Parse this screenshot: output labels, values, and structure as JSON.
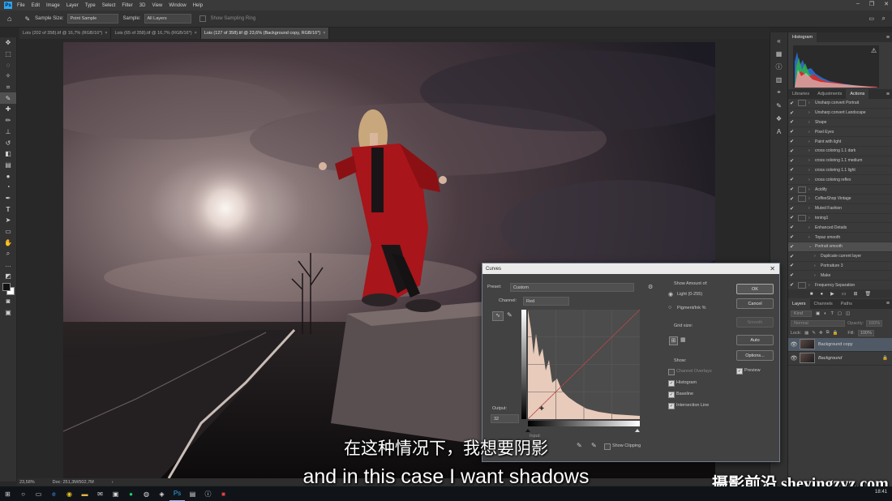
{
  "menu": [
    "File",
    "Edit",
    "Image",
    "Layer",
    "Type",
    "Select",
    "Filter",
    "3D",
    "View",
    "Window",
    "Help"
  ],
  "app_logo": "Ps",
  "options": {
    "sample_size_label": "Sample Size:",
    "sample_size_value": "Point Sample",
    "sample_label": "Sample:",
    "sample_value": "All Layers",
    "ring_label": "Show Sampling Ring"
  },
  "tabs": [
    {
      "label": "Lois (202 of 358).tif @ 16,7% (RGB/16*)",
      "close": "×"
    },
    {
      "label": "Lois (65 of 358).tif @ 16,7% (RGB/16*)",
      "close": "×"
    },
    {
      "label": "Lois (127 of 358).tif @ 23,6% (Background copy, RGB/16*)",
      "close": "×"
    }
  ],
  "status": {
    "zoom": "23,58%",
    "doc": "Doc: 251,3M/502,7M"
  },
  "panels": {
    "histogram_tab": "Histogram",
    "mid_tabs": [
      "Libraries",
      "Adjustments",
      "Actions"
    ],
    "actions": [
      {
        "name": "Unsharp convert Portrait",
        "check": "✔",
        "box": true,
        "tri": "›"
      },
      {
        "name": "Unsharp convert Landscape",
        "check": "✔",
        "box": false,
        "tri": "›"
      },
      {
        "name": "Shape",
        "check": "✔",
        "box": false,
        "tri": "›"
      },
      {
        "name": "Pixel Eyes",
        "check": "✔",
        "box": false,
        "tri": "›"
      },
      {
        "name": "Paint with light",
        "check": "✔",
        "box": false,
        "tri": "›"
      },
      {
        "name": "cross coloring 1.1 dark",
        "check": "✔",
        "box": false,
        "tri": "›"
      },
      {
        "name": "cross coloring 1.1 medium",
        "check": "✔",
        "box": false,
        "tri": "›"
      },
      {
        "name": "cross coloring 1.1 light",
        "check": "✔",
        "box": false,
        "tri": "›"
      },
      {
        "name": "cross coloring reflex",
        "check": "✔",
        "box": false,
        "tri": "›"
      },
      {
        "name": "Acidify",
        "check": "✔",
        "box": true,
        "tri": "›"
      },
      {
        "name": "CoffeeShop Vintage",
        "check": "✔",
        "box": true,
        "tri": "›"
      },
      {
        "name": "Muted Fashion",
        "check": "✔",
        "box": false,
        "tri": "›"
      },
      {
        "name": "toning1",
        "check": "✔",
        "box": true,
        "tri": "›"
      },
      {
        "name": "Enhanced Details",
        "check": "✔",
        "box": false,
        "tri": "›"
      },
      {
        "name": "Topaz smooth",
        "check": "✔",
        "box": false,
        "tri": "›"
      },
      {
        "name": "Portrait smooth",
        "check": "✔",
        "box": false,
        "tri": "⌄"
      },
      {
        "name": "Duplicate current layer",
        "check": "✔",
        "box": false,
        "tri": "›"
      },
      {
        "name": "Portraiture 3",
        "check": "✔",
        "box": false,
        "tri": "›"
      },
      {
        "name": "Make",
        "check": "✔",
        "box": false,
        "tri": "›"
      },
      {
        "name": "Frequency Separation",
        "check": "✔",
        "box": true,
        "tri": "›"
      }
    ],
    "layers_tabs": [
      "Layers",
      "Channels",
      "Paths"
    ],
    "layer_kind": "Kind",
    "blend_mode": "Normal",
    "opacity_label": "Opacity:",
    "opacity_value": "100%",
    "lock_label": "Lock:",
    "fill_label": "Fill:",
    "fill_value": "100%",
    "layers": [
      {
        "name": "Background copy",
        "selected": true
      },
      {
        "name": "Background",
        "selected": false
      }
    ]
  },
  "curves": {
    "title": "Curves",
    "close": "✕",
    "preset_label": "Preset:",
    "preset_value": "Custom",
    "channel_label": "Channel:",
    "channel_value": "Red",
    "output_label": "Output:",
    "output_value": "32",
    "input_label": "Input:",
    "show_clipping": "Show Clipping",
    "show_amount_label": "Show Amount of:",
    "light_option": "Light  (0-255)",
    "pigment_option": "Pigment/Ink %",
    "grid_size_label": "Grid size:",
    "show_label": "Show:",
    "channel_overlays": "Channel Overlays",
    "histogram": "Histogram",
    "baseline": "Baseline",
    "intersection_line": "Intersection Line",
    "ok": "OK",
    "cancel": "Cancel",
    "smooth": "Smooth",
    "auto": "Auto",
    "options": "Options...",
    "preview": "Preview"
  },
  "subtitles": {
    "chinese": "在这种情况下，我想要阴影",
    "english": "and in this case I want shadows"
  },
  "watermark": "摄影前沿 sheyingzyz.com",
  "taskbar": {
    "clock": "18:41"
  }
}
